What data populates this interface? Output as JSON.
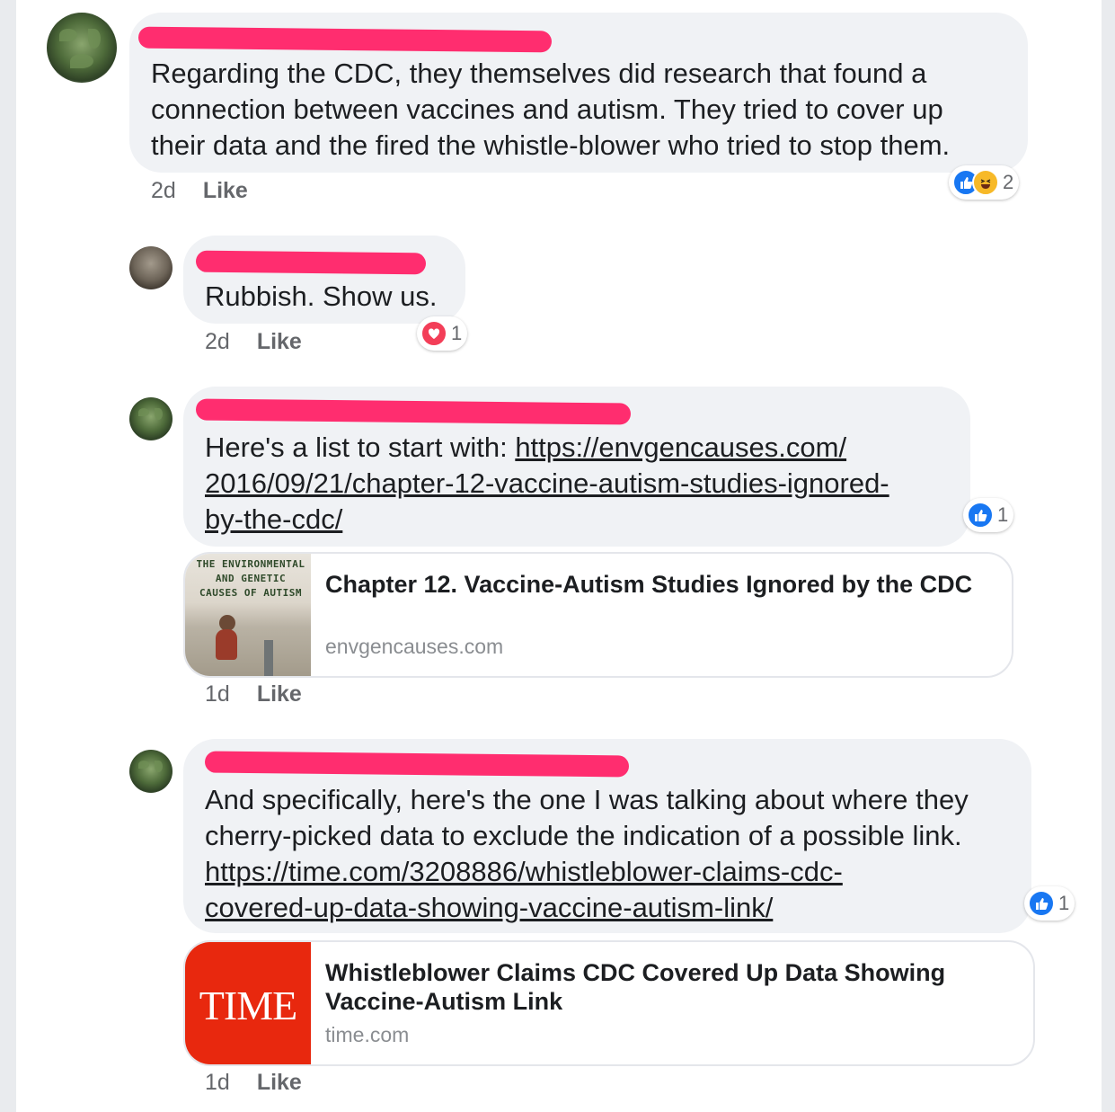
{
  "comments": [
    {
      "text": "Regarding the CDC, they themselves did research that found a\nconnection between vaccines and autism. They tried to cover up\ntheir data and the fired the whistle-blower who tried to stop them.",
      "time": "2d",
      "like_label": "Like",
      "reactions": {
        "types": [
          "like",
          "haha"
        ],
        "count": "2"
      }
    },
    {
      "text": "Rubbish. Show us.",
      "time": "2d",
      "like_label": "Like",
      "reactions": {
        "types": [
          "love"
        ],
        "count": "1"
      }
    },
    {
      "text_prefix": "Here's a list to start with: ",
      "link_lines": [
        "https://envgencauses.com/",
        "2016/09/21/chapter-12-vaccine-autism-studies-ignored-",
        "by-the-cdc/"
      ],
      "time": "1d",
      "like_label": "Like",
      "reactions": {
        "types": [
          "like"
        ],
        "count": "1"
      },
      "preview": {
        "thumb_text": "THE ENVIRONMENTAL AND GENETIC CAUSES OF AUTISM",
        "title": "Chapter 12. Vaccine-Autism Studies Ignored by the CDC",
        "domain": "envgencauses.com"
      }
    },
    {
      "text": "And specifically, here's the one I was talking about where they\ncherry-picked data to exclude the indication of a possible link.",
      "link_lines": [
        "https://time.com/3208886/whistleblower-claims-cdc-",
        "covered-up-data-showing-vaccine-autism-link/"
      ],
      "time": "1d",
      "like_label": "Like",
      "reactions": {
        "types": [
          "like"
        ],
        "count": "1"
      },
      "preview": {
        "thumb_text": "TIME",
        "title": "Whistleblower Claims CDC Covered Up Data Showing Vaccine-Autism Link",
        "domain": "time.com"
      }
    }
  ],
  "colors": {
    "bubble": "#f0f2f5",
    "redaction": "#ff2d6f",
    "like_blue": "#1877f2",
    "love_red": "#f33e58",
    "haha_yellow": "#f7b928",
    "time_red": "#e8280e"
  }
}
